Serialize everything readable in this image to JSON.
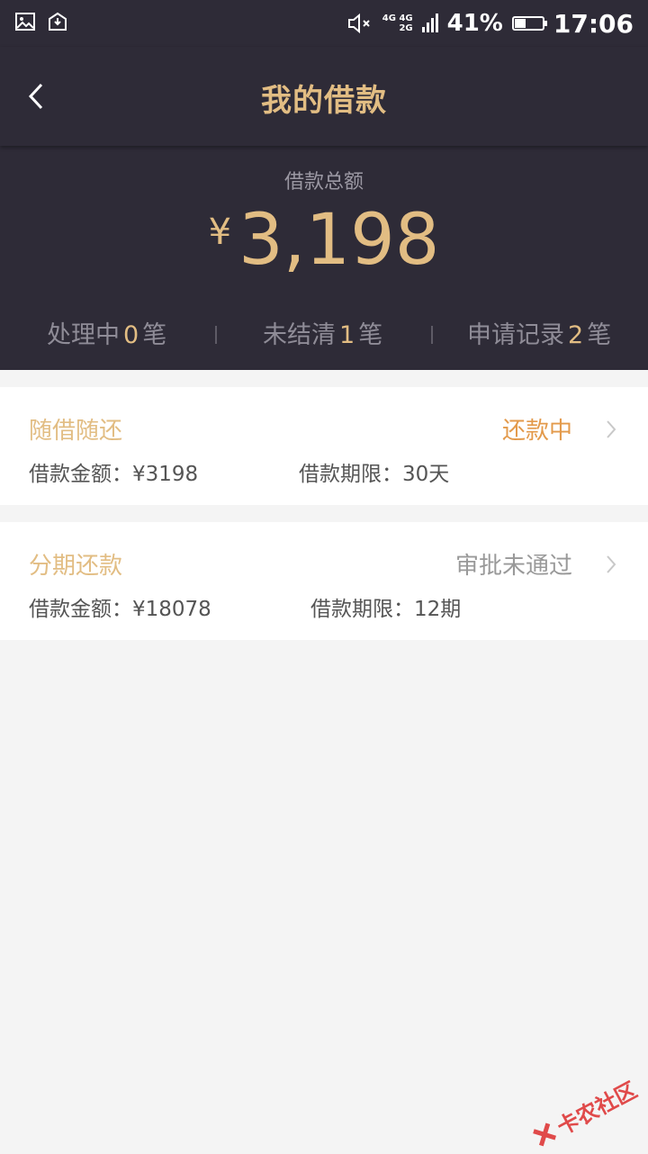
{
  "status_bar": {
    "network_top": "4G 4G",
    "network_bottom": "2G",
    "battery_percent": "41%",
    "battery_level": 0.41,
    "time": "17:06",
    "icons": [
      "image-icon",
      "mail-download-icon",
      "mute-icon",
      "signal-icon",
      "battery-icon"
    ]
  },
  "header": {
    "title": "我的借款",
    "back_icon": "chevron-left-icon"
  },
  "summary": {
    "total_label": "借款总额",
    "currency": "¥",
    "total_amount": "3,198",
    "stats": [
      {
        "label": "处理中",
        "count": "0",
        "unit": "笔"
      },
      {
        "label": "未结清",
        "count": "1",
        "unit": "笔"
      },
      {
        "label": "申请记录",
        "count": "2",
        "unit": "笔"
      }
    ]
  },
  "loans": [
    {
      "type": "随借随还",
      "status": "还款中",
      "status_color": "#e39a4b",
      "amount_text": "借款金额：¥3198",
      "term_text": "借款期限：30天"
    },
    {
      "type": "分期还款",
      "status": "审批未通过",
      "status_color": "#999999",
      "amount_text": "借款金额：¥18078",
      "term_text": "借款期限：12期"
    }
  ],
  "watermark": "卡农社区",
  "colors": {
    "header_bg": "#2e2b37",
    "accent_gold": "#e2bd83",
    "page_bg": "#f4f4f4"
  }
}
